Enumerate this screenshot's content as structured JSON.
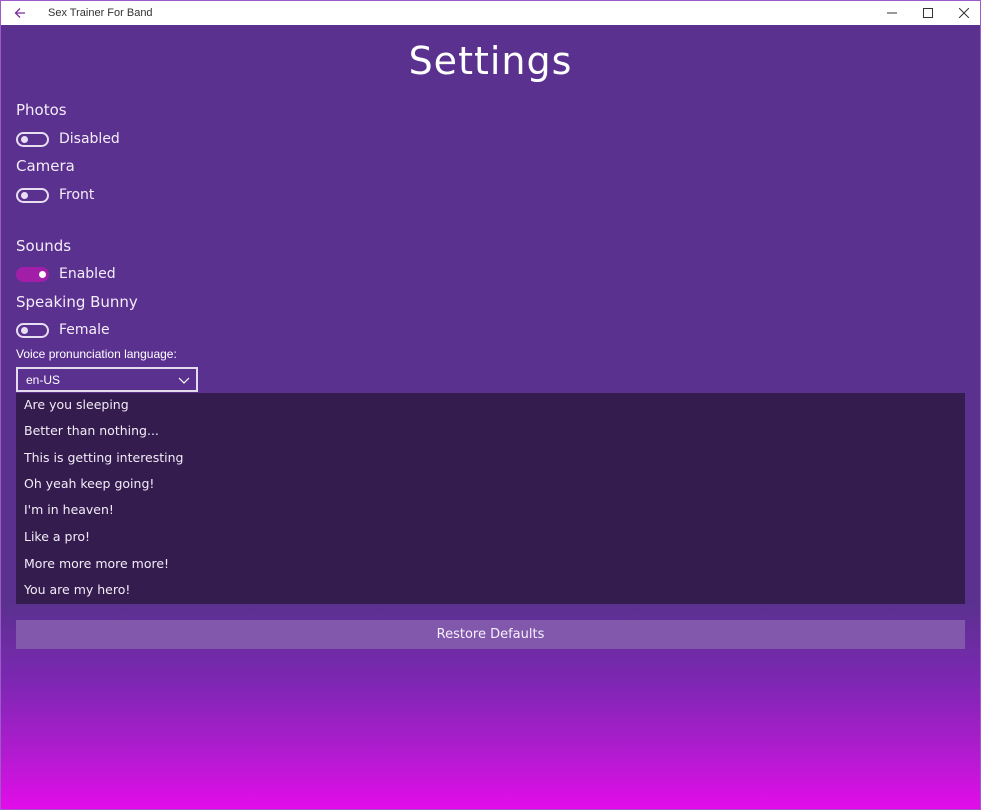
{
  "window": {
    "title": "Sex Trainer For Band"
  },
  "page": {
    "title": "Settings"
  },
  "settings": {
    "photos": {
      "label": "Photos",
      "state_text": "Disabled",
      "on": false
    },
    "camera": {
      "label": "Camera",
      "state_text": "Front",
      "on": false
    },
    "sounds": {
      "label": "Sounds",
      "state_text": "Enabled",
      "on": true
    },
    "speaking_bunny": {
      "label": "Speaking Bunny",
      "state_text": "Female",
      "on": false
    }
  },
  "voice": {
    "label": "Voice pronunciation language:",
    "selected": "en-US"
  },
  "phrases": [
    "Are you sleeping",
    "Better than nothing...",
    "This is getting interesting",
    "Oh yeah keep going!",
    "I'm in heaven!",
    "Like a pro!",
    "More more more more!",
    "You are my hero!"
  ],
  "restore_label": "Restore Defaults",
  "colors": {
    "background": "#5b3190",
    "gradient_end": "#e30ce9",
    "phrase_panel": "#351c4f",
    "toggle_on": "#a21ea9",
    "button": "#8258ad"
  },
  "icons": {
    "back": "back-arrow-icon",
    "minimize": "minimize-icon",
    "maximize": "maximize-icon",
    "close": "close-icon",
    "dropdown": "chevron-down-icon"
  }
}
